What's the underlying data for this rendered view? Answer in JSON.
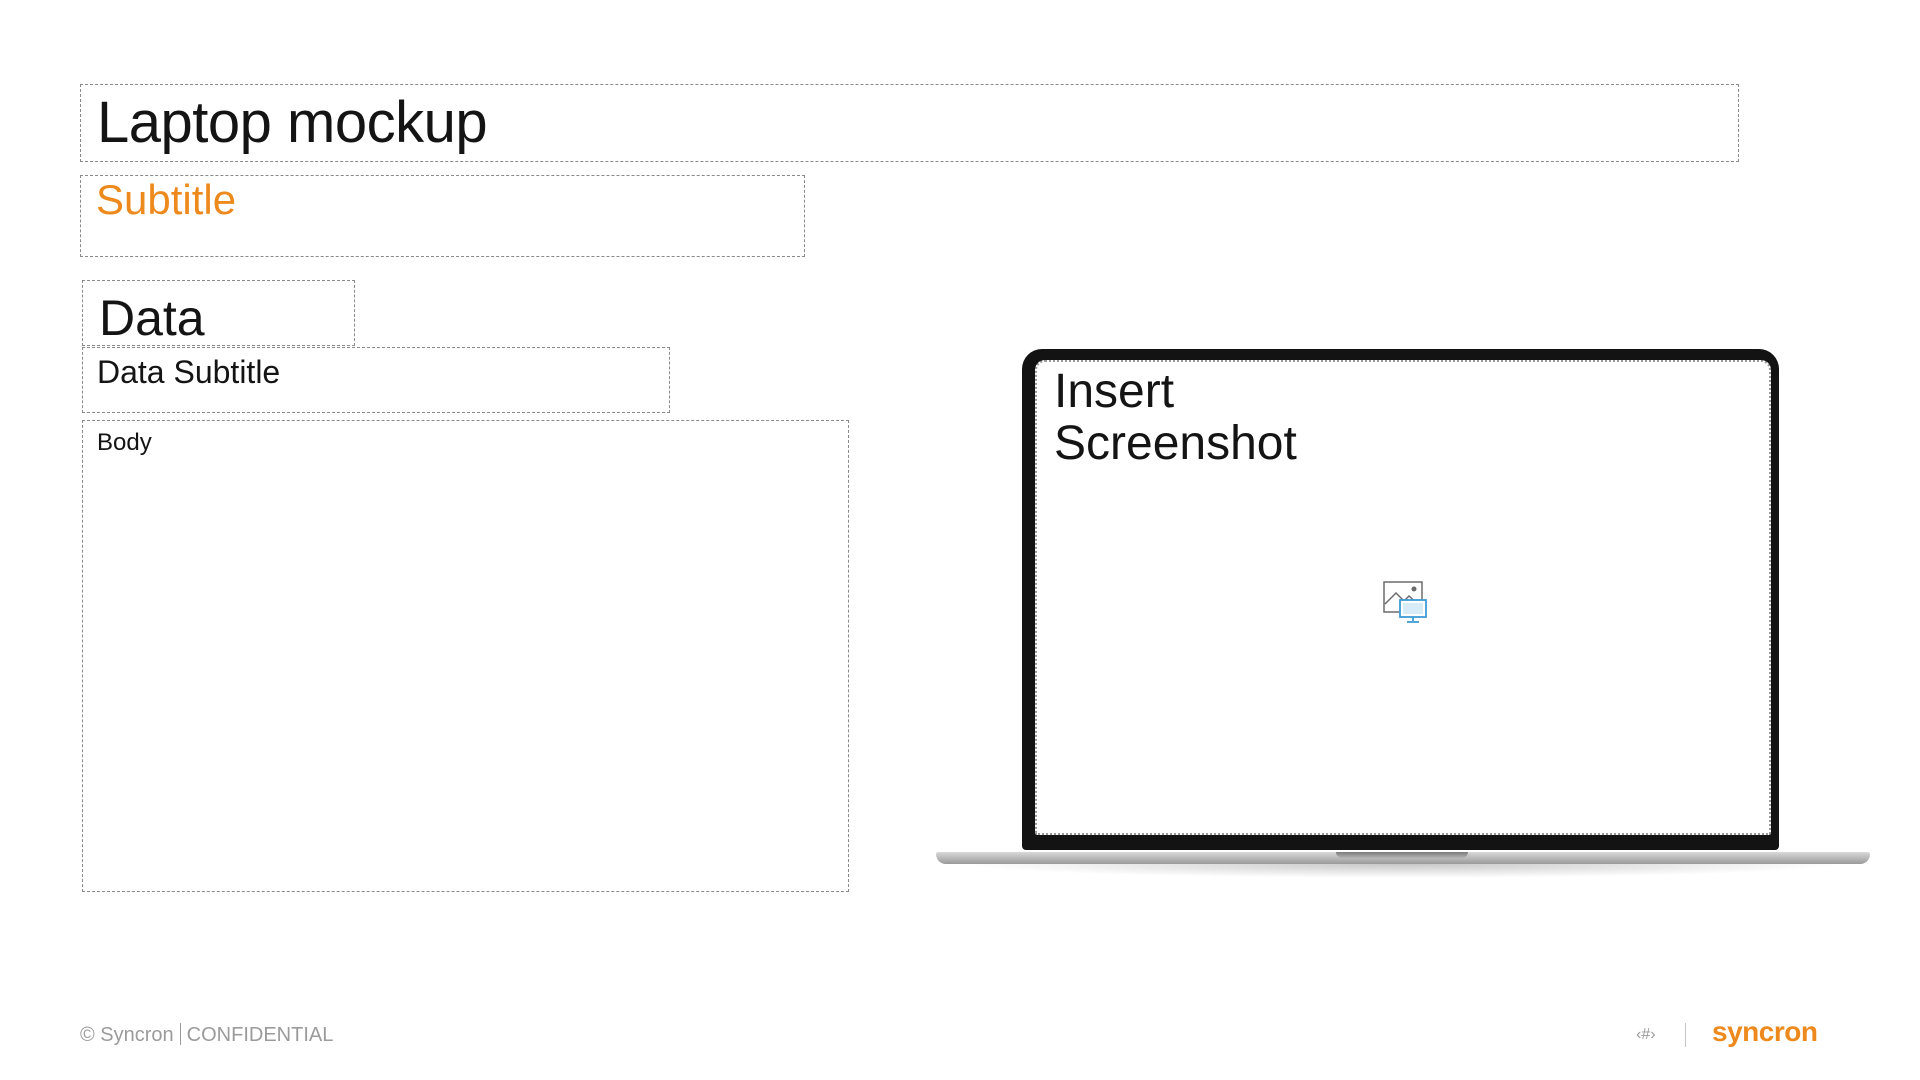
{
  "slide": {
    "title": "Laptop mockup",
    "subtitle": "Subtitle",
    "data_heading": "Data",
    "data_subtitle": "Data Subtitle",
    "body": "Body"
  },
  "laptop": {
    "screen_label_line1": "Insert",
    "screen_label_line2": "Screenshot",
    "insert_icon": "insert-picture-icon"
  },
  "footer": {
    "copyright": "© Syncron",
    "confidential": "CONFIDENTIAL",
    "page_number": "‹#›",
    "brand": "syncron"
  },
  "colors": {
    "accent": "#ee8a1d",
    "text": "#141414",
    "footer_text": "#9b9b9b",
    "icon_blue": "#3d9bd6"
  }
}
